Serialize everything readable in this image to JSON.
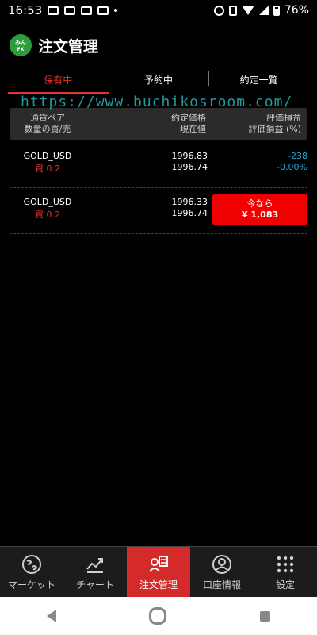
{
  "status": {
    "time": "16:53",
    "battery": "76%"
  },
  "header": {
    "logo_text": "みんなのFX",
    "title": "注文管理"
  },
  "tabs": [
    {
      "label": "保有中",
      "active": true
    },
    {
      "label": "予約中",
      "active": false
    },
    {
      "label": "約定一覧",
      "active": false
    }
  ],
  "watermark": "https://www.buchikosroom.com/",
  "table": {
    "col1_line1": "通貨ペア",
    "col1_line2": "数量の買/売",
    "col2_line1": "約定価格",
    "col2_line2": "現在値",
    "col3_line1": "評価損益",
    "col3_line2": "評価損益 (%)"
  },
  "positions": [
    {
      "pair": "GOLD_USD",
      "side": "買 0.2",
      "entry_price": "1996.83",
      "current_price": "1996.74",
      "pl": "-238",
      "pl_percent": "-0.00%"
    },
    {
      "pair": "GOLD_USD",
      "side": "買 0.2",
      "entry_price": "1996.33",
      "current_price": "1996.74",
      "button_line1": "今なら",
      "button_line2": "¥ 1,083"
    }
  ],
  "colors": {
    "accent": "#e5322d",
    "negative": "#1aa7e0",
    "button": "#f00000",
    "nav_active": "#d42a2a"
  },
  "bottom_nav": [
    {
      "label": "マーケット",
      "icon": "globe-icon",
      "active": false
    },
    {
      "label": "チャート",
      "icon": "chart-icon",
      "active": false
    },
    {
      "label": "注文管理",
      "icon": "order-icon",
      "active": true
    },
    {
      "label": "口座情報",
      "icon": "account-icon",
      "active": false
    },
    {
      "label": "設定",
      "icon": "settings-grid-icon",
      "active": false
    }
  ]
}
